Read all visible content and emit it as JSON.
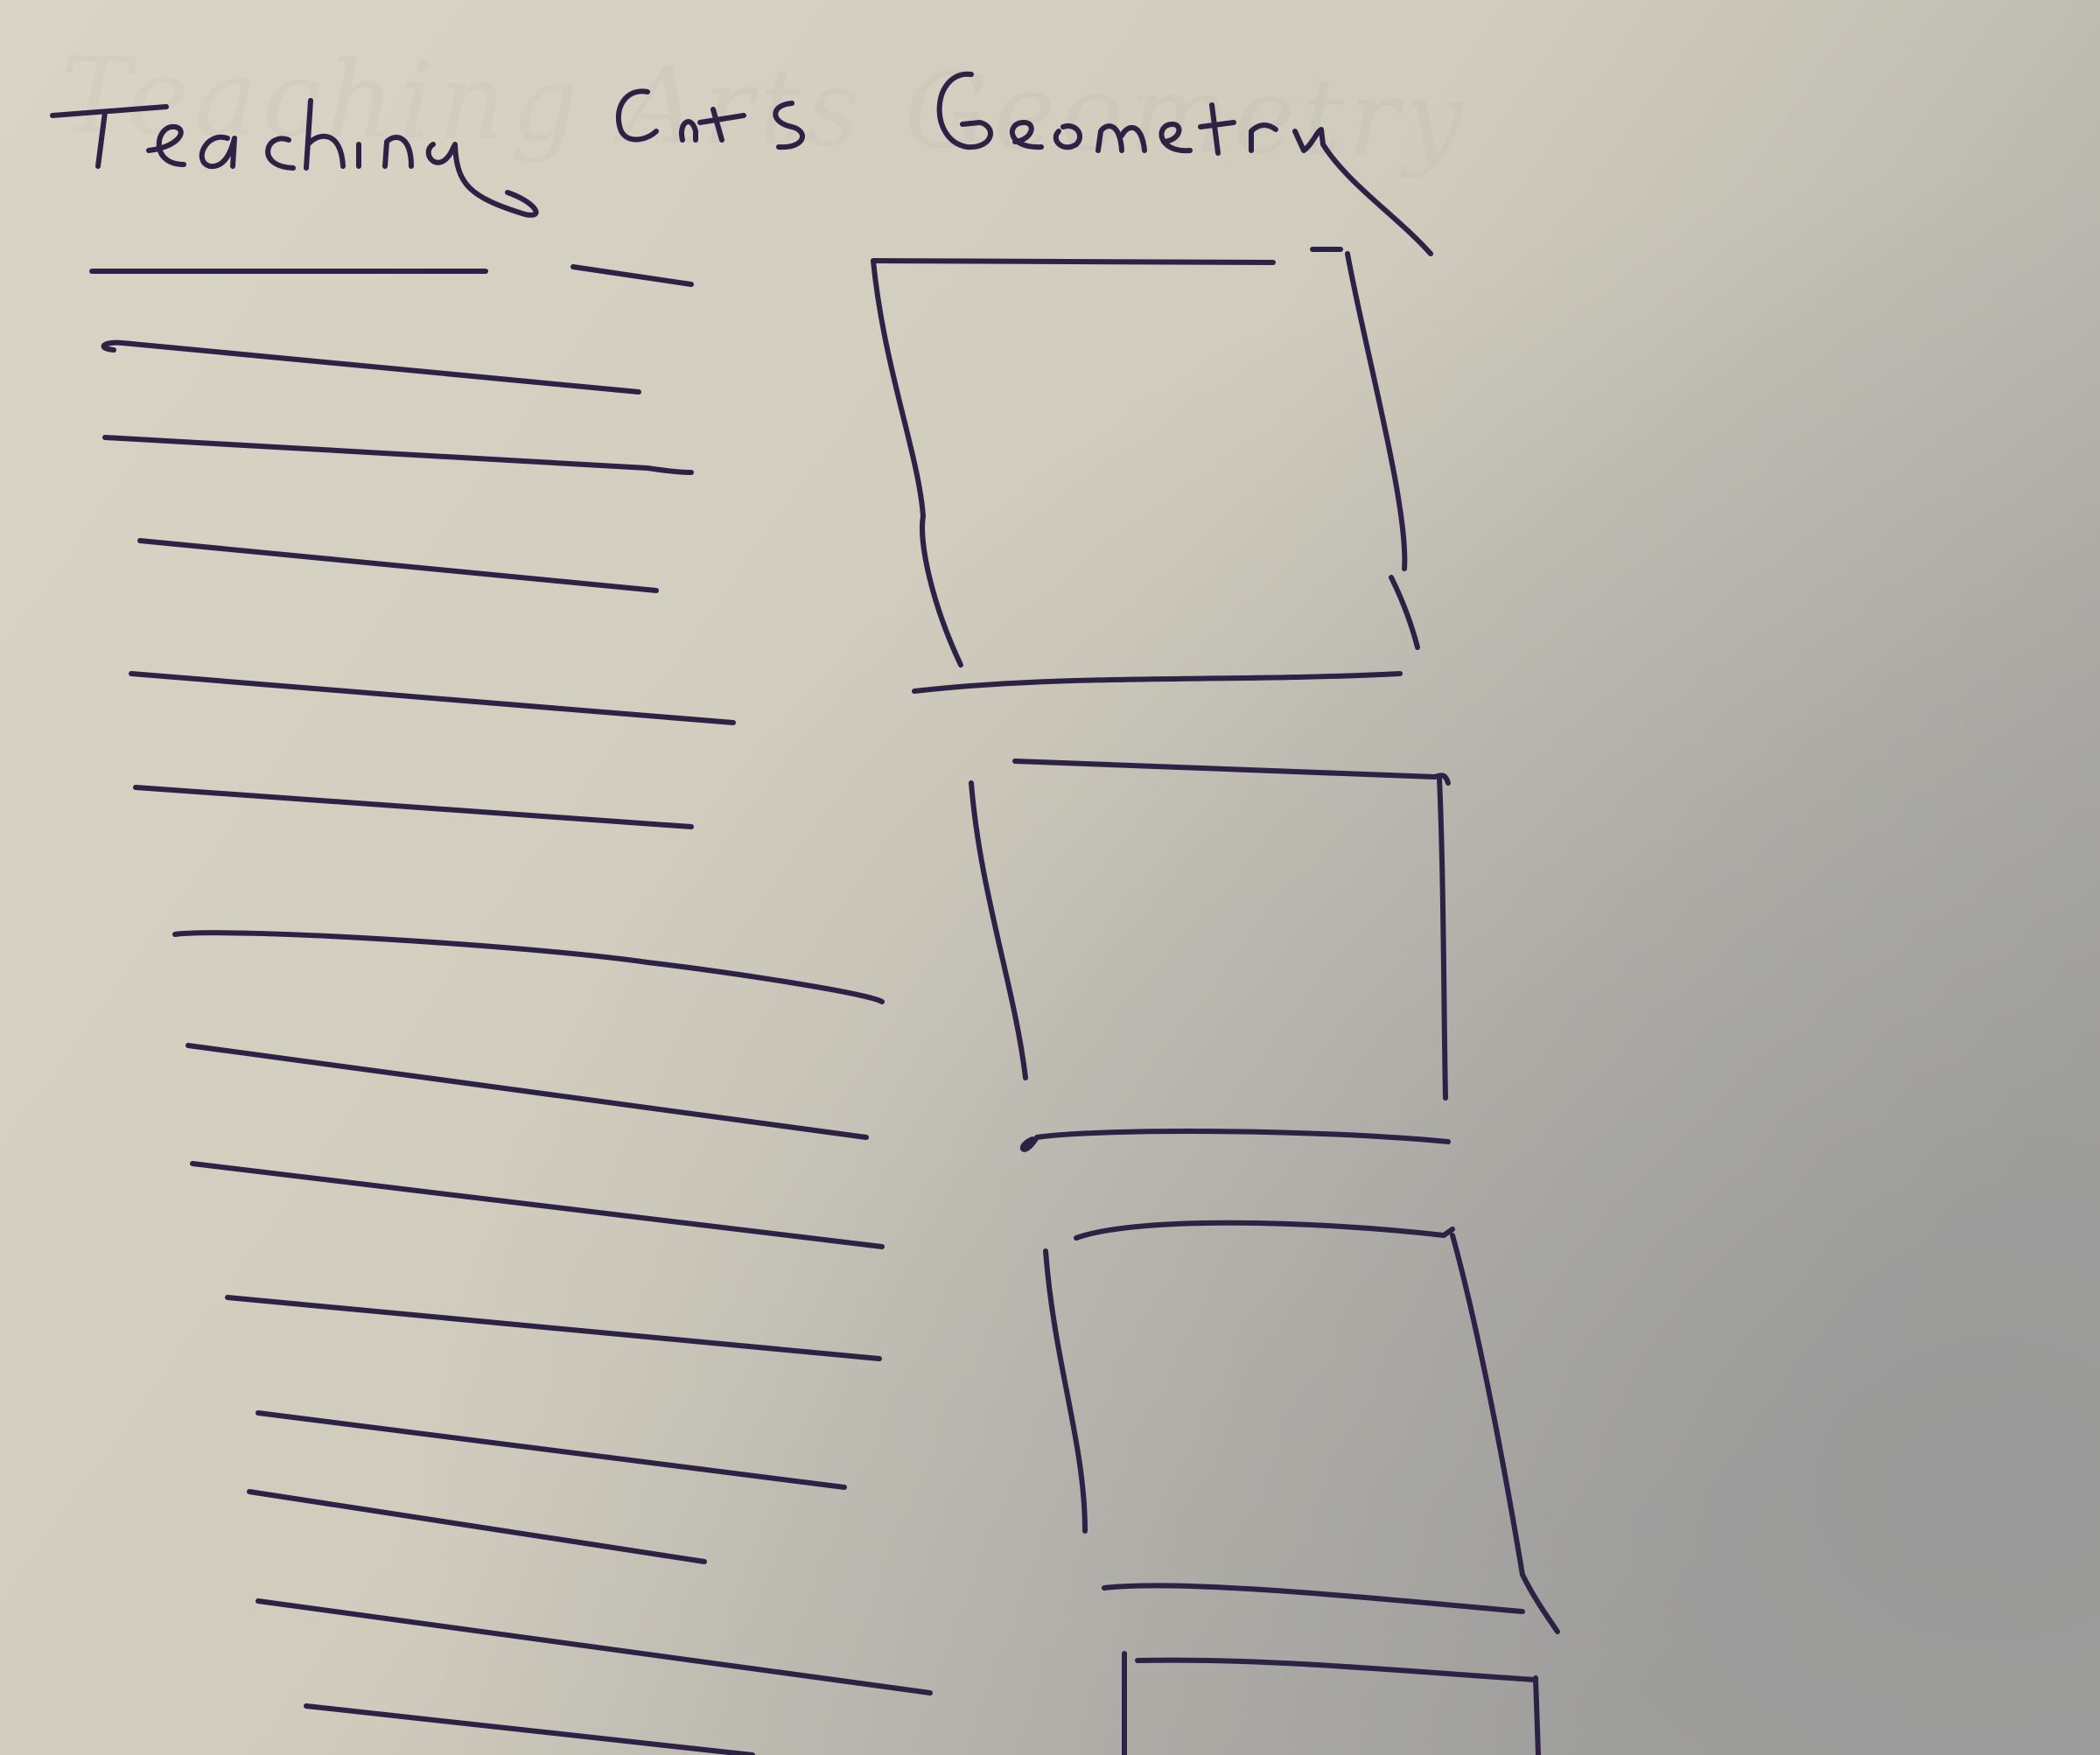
{
  "sheet": {
    "title": "Teaching Arts Geometry",
    "ink_color": "#2e2146",
    "paper_color": "#d6d1c4",
    "text_lines": 14,
    "boxes": 4
  }
}
